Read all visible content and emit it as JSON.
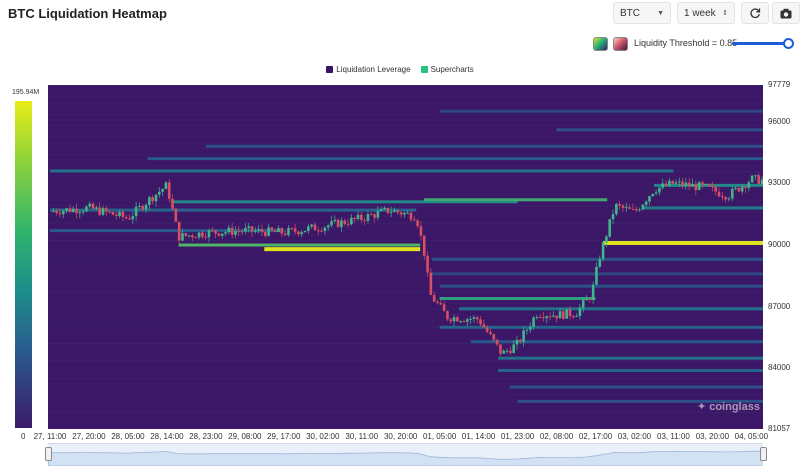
{
  "header": {
    "title": "BTC Liquidation Heatmap"
  },
  "controls": {
    "coin": "BTC",
    "range": "1 week",
    "threshold_label": "Liquidity Threshold = 0.85",
    "threshold_value": 0.85
  },
  "icons": {
    "refresh": "refresh-icon",
    "camera": "camera-icon",
    "caret": "chevron-updown-icon"
  },
  "legend": [
    {
      "label": "Liquidation Leverage",
      "color": "#3b1163"
    },
    {
      "label": "Supercharts",
      "color": "#26c281"
    }
  ],
  "colors": {
    "accent": "#1a5fd4",
    "heat_low": "#3b1a6a",
    "heat_mid": "#1f9a8a",
    "heat_high": "#e8ed18",
    "candle_up": "#3fb68b",
    "candle_down": "#d64f62"
  },
  "scale": {
    "max_label": "195.94M",
    "min_label": "0"
  },
  "watermark": "coinglass",
  "chart_data": {
    "type": "heatmap",
    "title": "BTC Liquidation Heatmap",
    "xlabel": "",
    "ylabel": "",
    "x_ticks": [
      "27, 11:00",
      "27, 20:00",
      "28, 05:00",
      "28, 14:00",
      "28, 23:00",
      "29, 08:00",
      "29, 17:00",
      "30, 02:00",
      "30, 11:00",
      "30, 20:00",
      "01, 05:00",
      "01, 14:00",
      "01, 23:00",
      "02, 08:00",
      "02, 17:00",
      "03, 02:00",
      "03, 11:00",
      "03, 20:00",
      "04, 05:00"
    ],
    "y_ticks": [
      "97779",
      "96000",
      "93000",
      "90000",
      "87000",
      "84000",
      "81057"
    ],
    "y_tick_values": [
      97779,
      96000,
      93000,
      90000,
      87000,
      84000,
      81057
    ],
    "ylim": [
      81057,
      97779
    ],
    "colorbar_range": [
      "0",
      "195.94M"
    ],
    "price_path": [
      {
        "x": 0.0,
        "y": 91650
      },
      {
        "x": 1.0,
        "y": 91800
      },
      {
        "x": 2.0,
        "y": 91300
      },
      {
        "x": 2.6,
        "y": 92300
      },
      {
        "x": 3.0,
        "y": 92900
      },
      {
        "x": 3.3,
        "y": 90400
      },
      {
        "x": 4.0,
        "y": 90600
      },
      {
        "x": 5.0,
        "y": 90700
      },
      {
        "x": 6.0,
        "y": 90600
      },
      {
        "x": 7.0,
        "y": 90900
      },
      {
        "x": 8.0,
        "y": 91300
      },
      {
        "x": 8.7,
        "y": 91700
      },
      {
        "x": 9.4,
        "y": 91400
      },
      {
        "x": 9.6,
        "y": 89700
      },
      {
        "x": 9.75,
        "y": 87600
      },
      {
        "x": 10.2,
        "y": 86500
      },
      {
        "x": 11.0,
        "y": 86400
      },
      {
        "x": 11.6,
        "y": 84700
      },
      {
        "x": 12.0,
        "y": 85200
      },
      {
        "x": 12.5,
        "y": 86700
      },
      {
        "x": 13.0,
        "y": 86600
      },
      {
        "x": 13.5,
        "y": 86700
      },
      {
        "x": 13.9,
        "y": 87600
      },
      {
        "x": 14.1,
        "y": 89400
      },
      {
        "x": 14.5,
        "y": 91900
      },
      {
        "x": 15.0,
        "y": 91600
      },
      {
        "x": 15.5,
        "y": 92700
      },
      {
        "x": 16.0,
        "y": 93000
      },
      {
        "x": 16.8,
        "y": 92800
      },
      {
        "x": 17.4,
        "y": 92400
      },
      {
        "x": 18.0,
        "y": 93200
      },
      {
        "x": 18.5,
        "y": 93100
      }
    ],
    "bands": [
      {
        "y": 92100,
        "x_start": 3.1,
        "x_end": 12.0,
        "intensity": 0.55
      },
      {
        "y": 91700,
        "x_start": 0.0,
        "x_end": 9.4,
        "intensity": 0.4
      },
      {
        "y": 90700,
        "x_start": 0.0,
        "x_end": 6.0,
        "intensity": 0.35
      },
      {
        "y": 90000,
        "x_start": 3.3,
        "x_end": 9.5,
        "intensity": 0.75
      },
      {
        "y": 89800,
        "x_start": 5.5,
        "x_end": 9.5,
        "intensity": 1.0
      },
      {
        "y": 90100,
        "x_start": 14.2,
        "x_end": 18.9,
        "intensity": 1.0
      },
      {
        "y": 92200,
        "x_start": 9.6,
        "x_end": 14.3,
        "intensity": 0.7
      },
      {
        "y": 93600,
        "x_start": 0.0,
        "x_end": 16.0,
        "intensity": 0.45
      },
      {
        "y": 94200,
        "x_start": 2.5,
        "x_end": 18.9,
        "intensity": 0.35
      },
      {
        "y": 94800,
        "x_start": 4.0,
        "x_end": 18.9,
        "intensity": 0.3
      },
      {
        "y": 92900,
        "x_start": 15.5,
        "x_end": 18.9,
        "intensity": 0.55
      },
      {
        "y": 91800,
        "x_start": 15.2,
        "x_end": 18.9,
        "intensity": 0.5
      },
      {
        "y": 87400,
        "x_start": 10.0,
        "x_end": 14.0,
        "intensity": 0.65
      },
      {
        "y": 86900,
        "x_start": 10.5,
        "x_end": 18.9,
        "intensity": 0.45
      },
      {
        "y": 86000,
        "x_start": 10.0,
        "x_end": 18.9,
        "intensity": 0.4
      },
      {
        "y": 85300,
        "x_start": 10.8,
        "x_end": 18.9,
        "intensity": 0.35
      },
      {
        "y": 84500,
        "x_start": 11.5,
        "x_end": 18.9,
        "intensity": 0.45
      },
      {
        "y": 83900,
        "x_start": 11.5,
        "x_end": 18.9,
        "intensity": 0.4
      },
      {
        "y": 83100,
        "x_start": 11.8,
        "x_end": 18.9,
        "intensity": 0.3
      },
      {
        "y": 82400,
        "x_start": 12.0,
        "x_end": 18.9,
        "intensity": 0.3
      },
      {
        "y": 96500,
        "x_start": 10.0,
        "x_end": 18.9,
        "intensity": 0.25
      },
      {
        "y": 95600,
        "x_start": 13.0,
        "x_end": 18.9,
        "intensity": 0.3
      },
      {
        "y": 89300,
        "x_start": 9.8,
        "x_end": 18.9,
        "intensity": 0.3
      },
      {
        "y": 88600,
        "x_start": 9.8,
        "x_end": 18.9,
        "intensity": 0.25
      },
      {
        "y": 88000,
        "x_start": 10.0,
        "x_end": 18.9,
        "intensity": 0.3
      }
    ]
  }
}
